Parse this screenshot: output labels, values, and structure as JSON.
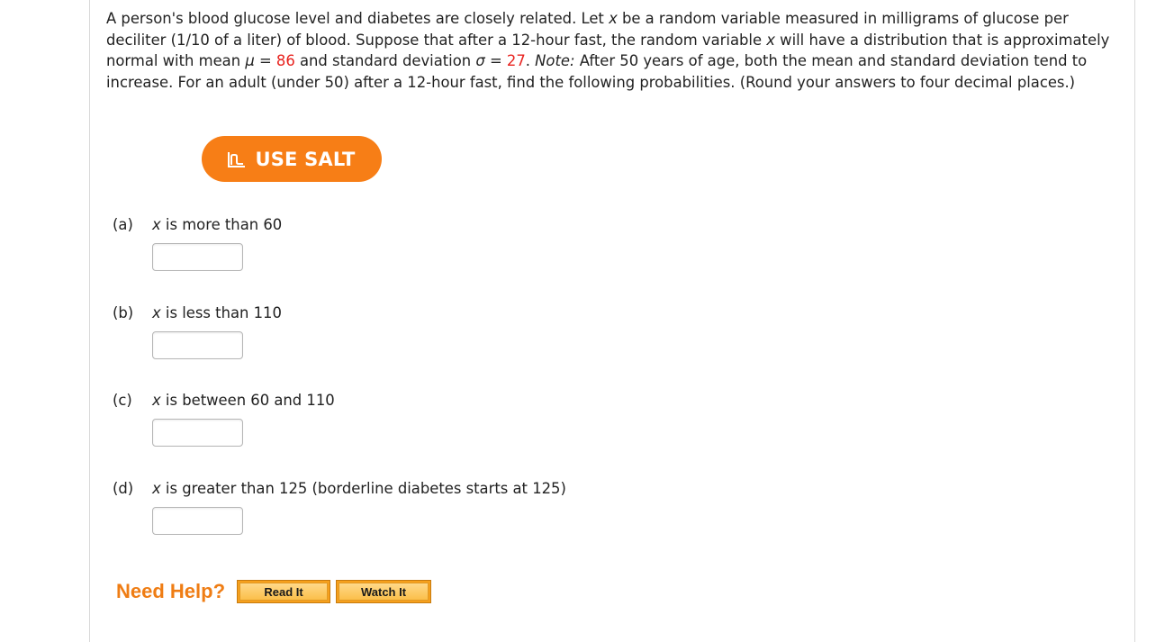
{
  "problem": {
    "part1": "A person's blood glucose level and diabetes are closely related. Let ",
    "var_x1": "x",
    "part2": " be a random variable measured in milligrams of glucose per deciliter (1/10 of a liter) of blood. Suppose that after a 12-hour fast, the random variable ",
    "var_x2": "x",
    "part3": " will have a distribution that is approximately normal with mean ",
    "mu_sym": "μ",
    "eq1": " = ",
    "mu_val": "86",
    "part4": " and standard deviation ",
    "sigma_sym": "σ",
    "eq2": " = ",
    "sigma_val": "27",
    "part5": ". ",
    "note_label": "Note:",
    "part6": " After 50 years of age, both the mean and standard deviation tend to increase. For an adult (under 50) after a 12-hour fast, find the following probabilities. (Round your answers to four decimal places.)"
  },
  "salt_button": {
    "label": "USE SALT",
    "icon": "salt-chart-icon"
  },
  "parts": [
    {
      "label": "(a)",
      "var": "x",
      "text": " is more than 60",
      "value": ""
    },
    {
      "label": "(b)",
      "var": "x",
      "text": " is less than 110",
      "value": ""
    },
    {
      "label": "(c)",
      "var": "x",
      "text": " is between 60 and 110",
      "value": ""
    },
    {
      "label": "(d)",
      "var": "x",
      "text": " is greater than 125 (borderline diabetes starts at 125)",
      "value": ""
    }
  ],
  "help": {
    "label": "Need Help?",
    "read_it": "Read It",
    "watch_it": "Watch It"
  },
  "colors": {
    "accent_orange": "#f77e16",
    "value_red": "#e8231f",
    "help_orange": "#ef7d14"
  }
}
